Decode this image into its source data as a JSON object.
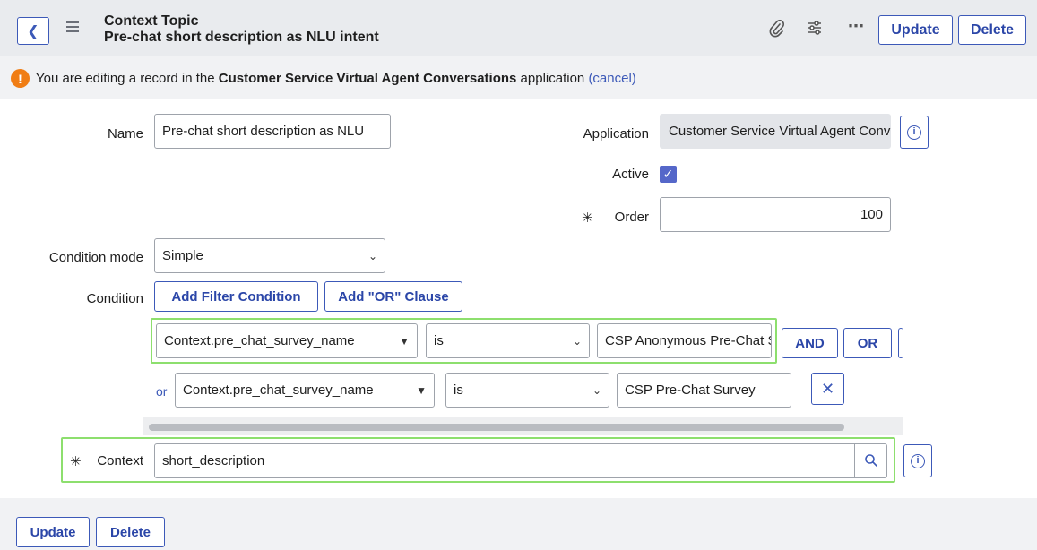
{
  "header": {
    "back_icon": "chevron-left-icon",
    "menu_icon": "hamburger-icon",
    "title": "Context Topic",
    "subtitle": "Pre-chat short description as NLU intent",
    "attach_icon": "paperclip-icon",
    "settings_icon": "sliders-icon",
    "more_icon": "ellipsis-icon",
    "update_label": "Update",
    "delete_label": "Delete"
  },
  "notice": {
    "icon": "warning-icon",
    "text_before": "You are editing a record in the ",
    "app_name": "Customer Service Virtual Agent Conversations",
    "text_after": " application ",
    "cancel_link": "(cancel)"
  },
  "form": {
    "name_label": "Name",
    "name_value": "Pre-chat short description as NLU",
    "application_label": "Application",
    "application_value": "Customer Service Virtual Agent Conversations",
    "active_label": "Active",
    "active_checked": true,
    "order_label": "Order",
    "order_value": "100",
    "condition_mode_label": "Condition mode",
    "condition_mode_value": "Simple",
    "condition_label": "Condition",
    "add_filter_label": "Add Filter Condition",
    "add_or_label": "Add \"OR\" Clause",
    "context_label": "Context",
    "context_value": "short_description",
    "required_marker": "✳"
  },
  "conditions": [
    {
      "prefix": "",
      "field": "Context.pre_chat_survey_name",
      "operator": "is",
      "value": "CSP Anonymous Pre-Chat Survey",
      "and_label": "AND",
      "or_label": "OR"
    },
    {
      "prefix": "or",
      "field": "Context.pre_chat_survey_name",
      "operator": "is",
      "value": "CSP Pre-Chat Survey",
      "remove_icon": "close-icon"
    }
  ],
  "footer": {
    "update_label": "Update",
    "delete_label": "Delete"
  },
  "colors": {
    "accent": "#3c59b8",
    "highlight": "#8ddf6e",
    "warning": "#f07d14"
  }
}
